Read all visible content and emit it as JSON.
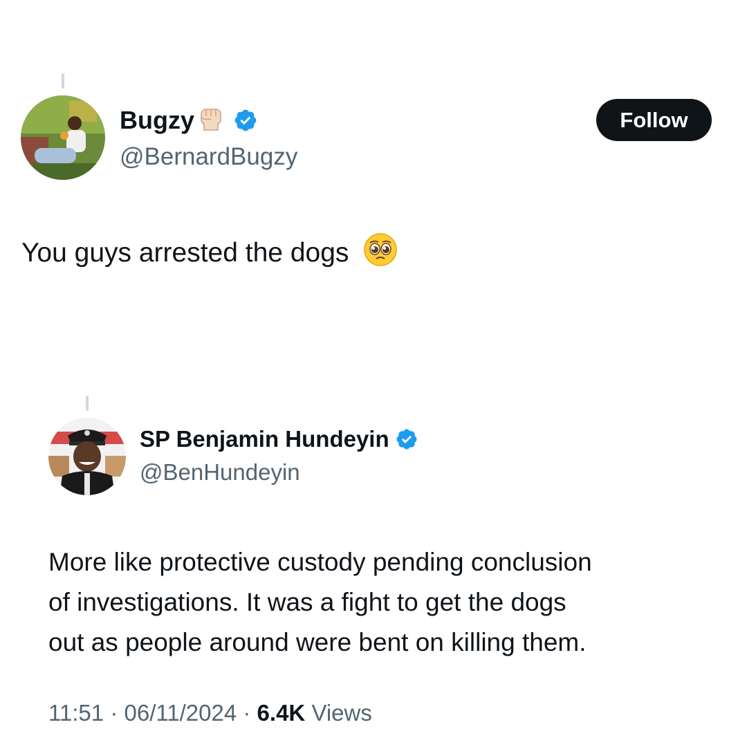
{
  "parent_tweet": {
    "author": {
      "display_name": "Bugzy",
      "name_emoji": "raised-fist-light-skin",
      "handle": "@BernardBugzy",
      "verified": true,
      "avatar": "avatar-photo-man-sitting"
    },
    "follow_label": "Follow",
    "text": "You guys arrested the dogs",
    "text_emoji": "pleading-face"
  },
  "reply_tweet": {
    "author": {
      "display_name": "SP Benjamin Hundeyin",
      "handle": "@BenHundeyin",
      "verified": true,
      "avatar": "avatar-photo-police-officer"
    },
    "text_lines": [
      "More like protective custody pending conclusion",
      "of investigations. It was a fight to get the dogs",
      "out as people around were bent on killing them."
    ],
    "time": "11:51",
    "separator": "·",
    "date": "06/11/2024",
    "views_count": "6.4K",
    "views_label": "Views"
  },
  "colors": {
    "text_primary": "#0f1419",
    "text_secondary": "#536471",
    "verified_blue": "#1d9bf0",
    "thread_line": "#cfd9de",
    "button_bg": "#0f1419"
  }
}
